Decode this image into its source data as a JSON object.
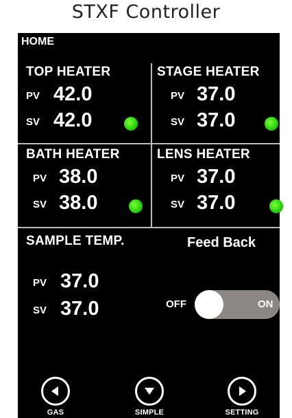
{
  "caption": "STXF Controller",
  "screen_title": "HOME",
  "units": {
    "top": {
      "title": "TOP HEATER",
      "pv_label": "PV",
      "pv": "42.0",
      "sv_label": "SV",
      "sv": "42.0"
    },
    "stage": {
      "title": "STAGE HEATER",
      "pv_label": "PV",
      "pv": "37.0",
      "sv_label": "SV",
      "sv": "37.0"
    },
    "bath": {
      "title": "BATH HEATER",
      "pv_label": "PV",
      "pv": "38.0",
      "sv_label": "SV",
      "sv": "38.0"
    },
    "lens": {
      "title": "LENS HEATER",
      "pv_label": "PV",
      "pv": "37.0",
      "sv_label": "SV",
      "sv": "37.0"
    },
    "sample": {
      "title": "SAMPLE TEMP.",
      "pv_label": "PV",
      "pv": "37.0",
      "sv_label": "SV",
      "sv": "37.0"
    }
  },
  "status_color": "#2bd40c",
  "feedback": {
    "title": "Feed Back",
    "off_label": "OFF",
    "on_label": "ON",
    "state": "OFF"
  },
  "nav": [
    {
      "label": "GAS",
      "icon": "left-arrow-icon"
    },
    {
      "label": "SIMPLE",
      "icon": "down-arrow-icon"
    },
    {
      "label": "SETTING",
      "icon": "right-arrow-icon"
    }
  ]
}
